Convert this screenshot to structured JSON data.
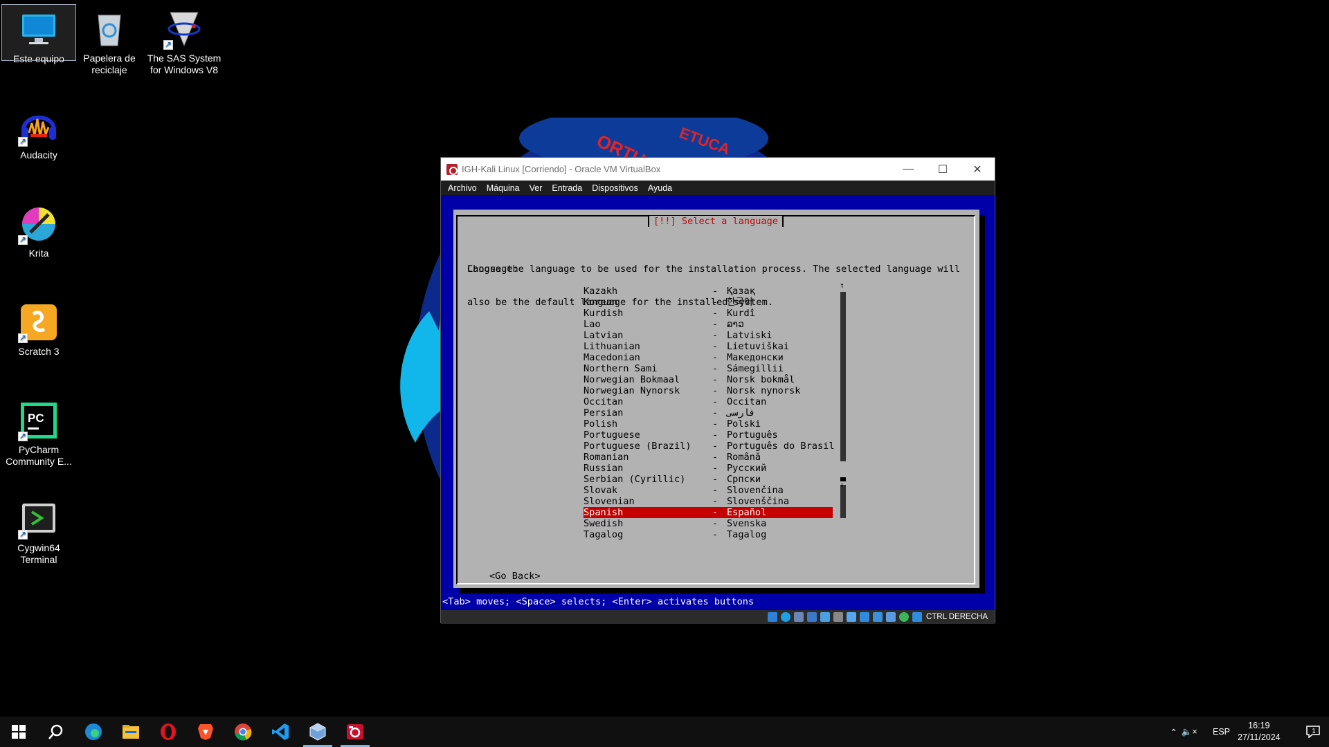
{
  "desktop": {
    "icons": [
      {
        "label": "Este equipo"
      },
      {
        "label": "Papelera de reciclaje"
      },
      {
        "label": "The SAS System for Windows V8"
      },
      {
        "label": "Audacity"
      },
      {
        "label": "Krita"
      },
      {
        "label": "Scratch 3"
      },
      {
        "label": "PyCharm Community E..."
      },
      {
        "label": "Cygwin64 Terminal"
      }
    ]
  },
  "vbox": {
    "title": "IGH-Kali Linux [Corriendo] - Oracle VM VirtualBox",
    "menu": [
      "Archivo",
      "Máquina",
      "Ver",
      "Entrada",
      "Dispositivos",
      "Ayuda"
    ],
    "host_key": "CTRL DERECHA"
  },
  "installer": {
    "dialog_title": "[!!] Select a language",
    "intro_line1": "Choose the language to be used for the installation process. The selected language will",
    "intro_line2": "also be the default language for the installed system.",
    "language_label": "Language:",
    "languages": [
      {
        "en": "Kazakh",
        "native": "Қазақ"
      },
      {
        "en": "Korean",
        "native": "한국어"
      },
      {
        "en": "Kurdish",
        "native": "Kurdî"
      },
      {
        "en": "Lao",
        "native": "ລາວ"
      },
      {
        "en": "Latvian",
        "native": "Latviski"
      },
      {
        "en": "Lithuanian",
        "native": "Lietuviškai"
      },
      {
        "en": "Macedonian",
        "native": "Македонски"
      },
      {
        "en": "Northern Sami",
        "native": "Sámegillii"
      },
      {
        "en": "Norwegian Bokmaal",
        "native": "Norsk bokmål"
      },
      {
        "en": "Norwegian Nynorsk",
        "native": "Norsk nynorsk"
      },
      {
        "en": "Occitan",
        "native": "Occitan"
      },
      {
        "en": "Persian",
        "native": "فارسی"
      },
      {
        "en": "Polish",
        "native": "Polski"
      },
      {
        "en": "Portuguese",
        "native": "Português"
      },
      {
        "en": "Portuguese (Brazil)",
        "native": "Português do Brasil"
      },
      {
        "en": "Romanian",
        "native": "Română"
      },
      {
        "en": "Russian",
        "native": "Русский"
      },
      {
        "en": "Serbian (Cyrillic)",
        "native": "Српски"
      },
      {
        "en": "Slovak",
        "native": "Slovenčina"
      },
      {
        "en": "Slovenian",
        "native": "Slovenščina"
      },
      {
        "en": "Spanish",
        "native": "Español"
      },
      {
        "en": "Swedish",
        "native": "Svenska"
      },
      {
        "en": "Tagalog",
        "native": "Tagalog"
      }
    ],
    "selected_language": "Spanish",
    "separator": "-",
    "go_back": "<Go Back>",
    "hint": "<Tab> moves; <Space> selects; <Enter> activates buttons"
  },
  "taskbar": {
    "apps": [
      "start-icon",
      "search-icon",
      "edge-icon",
      "file-explorer-icon",
      "opera-icon",
      "brave-icon",
      "chrome-icon",
      "vscode-icon",
      "virtualbox-icon",
      "debian-installer-icon"
    ],
    "language": "ESP",
    "time": "16:19",
    "date": "27/11/2024",
    "notification_count": "1"
  },
  "colors": {
    "vm_background": "#0000a8",
    "dialog": "#b2b2b2",
    "selection": "#c60000"
  }
}
